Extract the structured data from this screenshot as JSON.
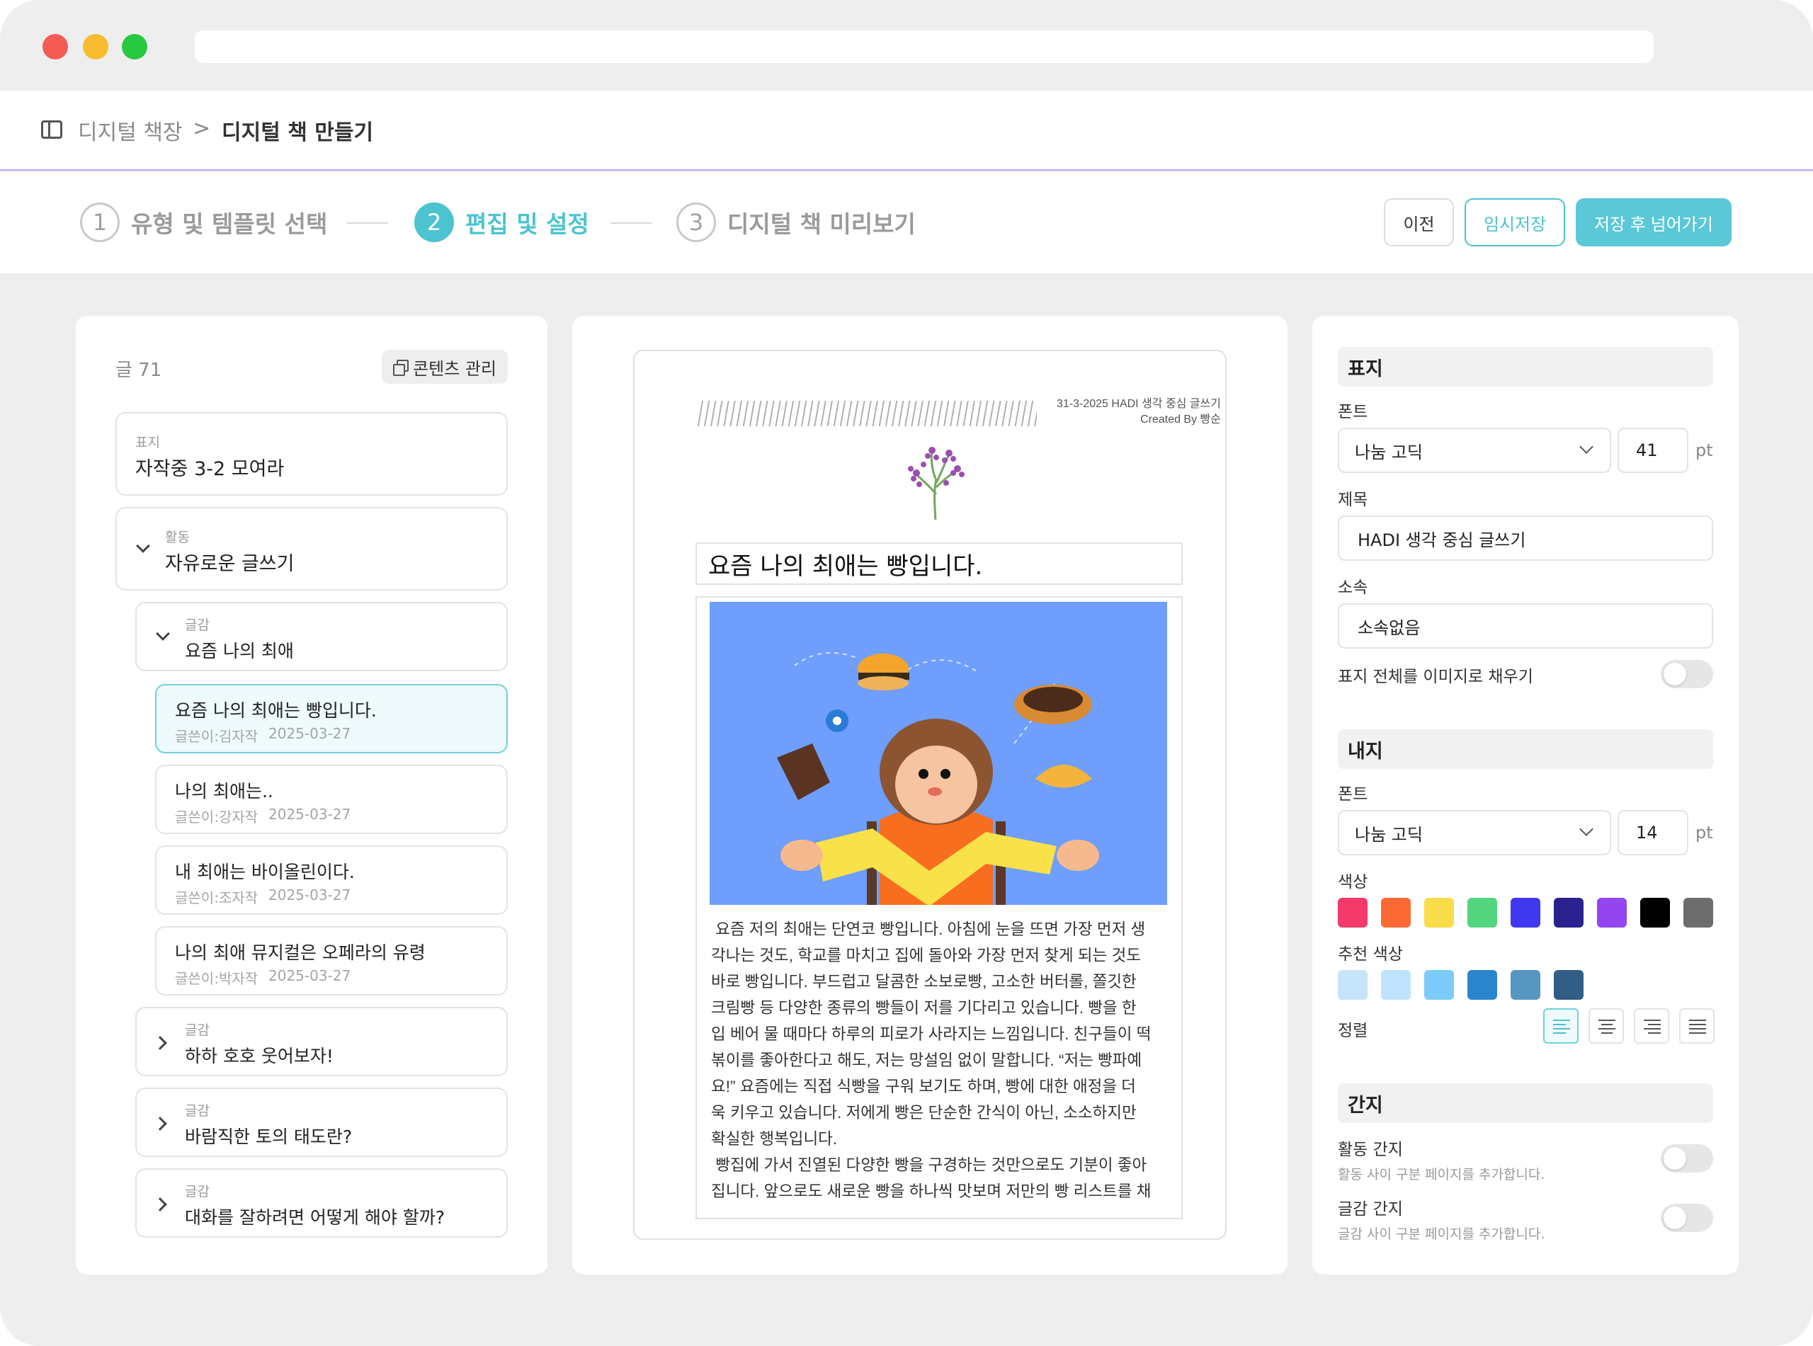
{
  "breadcrumb": {
    "parent": "디지털 책장",
    "separator": ">",
    "current": "디지털 책 만들기"
  },
  "stepper": {
    "steps": [
      {
        "num": "1",
        "label": "유형 및 템플릿 선택"
      },
      {
        "num": "2",
        "label": "편집 및 설정"
      },
      {
        "num": "3",
        "label": "디지털 책 미리보기"
      }
    ],
    "active_step": 2
  },
  "actions": {
    "prev": "이전",
    "temp_save": "임시저장",
    "save_next": "저장 후 넘어가기"
  },
  "left_panel": {
    "post_count": "글 71",
    "content_manage": "콘텐츠 관리",
    "cover_card": {
      "label": "표지",
      "title": "자작중 3-2 모여라"
    },
    "activity_card": {
      "label": "활동",
      "title": "자유로운 글쓰기"
    },
    "topic_open": {
      "label": "글감",
      "title": "요즘 나의 최애"
    },
    "posts": [
      {
        "title": "요즘 나의 최애는 빵입니다.",
        "author": "글쓴이:김자작",
        "date": "2025-03-27"
      },
      {
        "title": "나의 최애는..",
        "author": "글쓴이:강자작",
        "date": "2025-03-27"
      },
      {
        "title": "내 최애는 바이올린이다.",
        "author": "글쓴이:조자작",
        "date": "2025-03-27"
      },
      {
        "title": "나의 최애 뮤지컬은 오페라의 유령",
        "author": "글쓴이:박자작",
        "date": "2025-03-27"
      }
    ],
    "topics_closed": [
      {
        "label": "글감",
        "title": "하하 호호 웃어보자!"
      },
      {
        "label": "글감",
        "title": "바람직한 토의 태도란?"
      },
      {
        "label": "글감",
        "title": "대화를 잘하려면 어떻게 해야 할까?"
      }
    ]
  },
  "preview": {
    "header_line1": "31-3-2025 HADI 생각 중심 글쓰기",
    "header_line2": "Created By 빵순",
    "title": "요즘 나의 최애는 빵입니다.",
    "body_lines": [
      " 요즘 저의 최애는 단연코 빵입니다. 아침에 눈을 뜨면 가장 먼저 생",
      "각나는 것도, 학교를 마치고 집에 돌아와 가장 먼저 찾게 되는 것도",
      "바로 빵입니다. 부드럽고 달콤한 소보로빵, 고소한 버터롤, 쫄깃한",
      "크림빵 등 다양한 종류의 빵들이 저를 기다리고 있습니다. 빵을 한",
      "입 베어 물 때마다 하루의 피로가 사라지는 느낌입니다. 친구들이 떡",
      "볶이를 좋아한다고 해도, 저는 망설임 없이 말합니다. “저는 빵파예",
      "요!” 요즘에는 직접 식빵을 구워 보기도 하며, 빵에 대한 애정을 더",
      "욱 키우고 있습니다. 저에게 빵은 단순한 간식이 아닌, 소소하지만",
      "확실한 행복입니다.",
      " 빵집에 가서 진열된 다양한 빵을 구경하는 것만으로도 기분이 좋아",
      "집니다. 앞으로도 새로운 빵을 하나씩 맛보며 저만의 빵 리스트를 채"
    ]
  },
  "settings": {
    "cover": {
      "heading": "표지",
      "font_label": "폰트",
      "font_value": "나눔 고딕",
      "font_size": "41",
      "unit": "pt",
      "title_label": "제목",
      "title_value": "HADI 생각 중심 글쓰기",
      "affiliation_label": "소속",
      "affiliation_value": "소속없음",
      "fill_image_label": "표지 전체를 이미지로 채우기"
    },
    "inner": {
      "heading": "내지",
      "font_label": "폰트",
      "font_value": "나눔 고딕",
      "font_size": "14",
      "unit": "pt",
      "color_label": "색상",
      "colors": [
        "#f43a6b",
        "#fb6a34",
        "#f9dd4a",
        "#53d57f",
        "#4038ee",
        "#2b2290",
        "#9346ef",
        "#000000",
        "#6d6d6d"
      ],
      "recommended_label": "추천 색상",
      "recommended_colors": [
        "#c6e4fa",
        "#bfe3fc",
        "#7ccbf9",
        "#2a86cc",
        "#5896c2",
        "#325d86"
      ],
      "align_label": "정렬"
    },
    "divider": {
      "heading": "간지",
      "activity_label": "활동 간지",
      "activity_desc": "활동 사이 구분 페이지를 추가합니다.",
      "topic_label": "글감 간지",
      "topic_desc": "글감 사이 구분 페이지를 추가합니다."
    }
  },
  "colors": {
    "accent": "#4bc3d0",
    "background": "#eeeeee"
  }
}
